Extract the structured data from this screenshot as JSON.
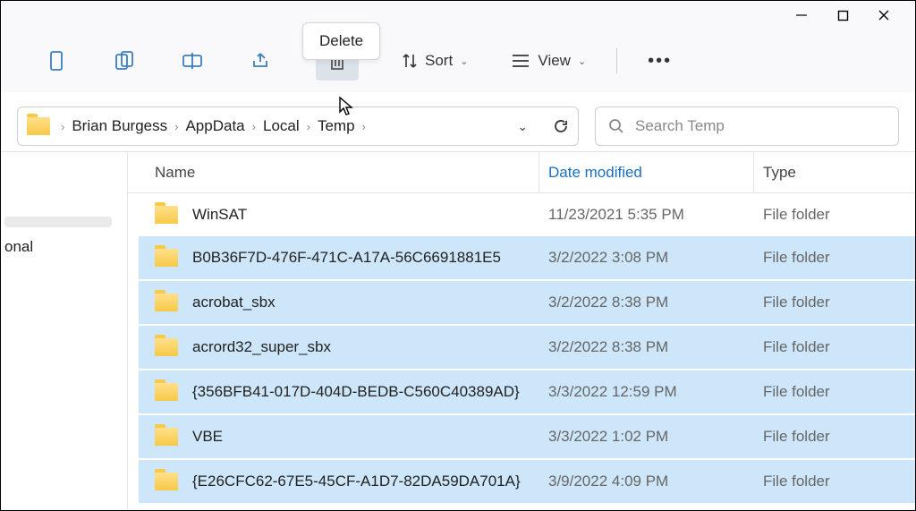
{
  "tooltip": "Delete",
  "toolbar": {
    "sort_label": "Sort",
    "view_label": "View"
  },
  "breadcrumbs": [
    "Brian Burgess",
    "AppData",
    "Local",
    "Temp"
  ],
  "search": {
    "placeholder": "Search Temp"
  },
  "navpane": {
    "item_selected": "",
    "item_1": "onal"
  },
  "columns": {
    "name": "Name",
    "date": "Date modified",
    "type": "Type"
  },
  "files": [
    {
      "name": "WinSAT",
      "date": "11/23/2021 5:35 PM",
      "type": "File folder",
      "selected": false
    },
    {
      "name": "B0B36F7D-476F-471C-A17A-56C6691881E5",
      "date": "3/2/2022 3:08 PM",
      "type": "File folder",
      "selected": true
    },
    {
      "name": "acrobat_sbx",
      "date": "3/2/2022 8:38 PM",
      "type": "File folder",
      "selected": true
    },
    {
      "name": "acrord32_super_sbx",
      "date": "3/2/2022 8:38 PM",
      "type": "File folder",
      "selected": true
    },
    {
      "name": "{356BFB41-017D-404D-BEDB-C560C40389AD}",
      "date": "3/3/2022 12:59 PM",
      "type": "File folder",
      "selected": true
    },
    {
      "name": "VBE",
      "date": "3/3/2022 1:02 PM",
      "type": "File folder",
      "selected": true
    },
    {
      "name": "{E26CFC62-67E5-45CF-A1D7-82DA59DA701A}",
      "date": "3/9/2022 4:09 PM",
      "type": "File folder",
      "selected": true
    }
  ]
}
